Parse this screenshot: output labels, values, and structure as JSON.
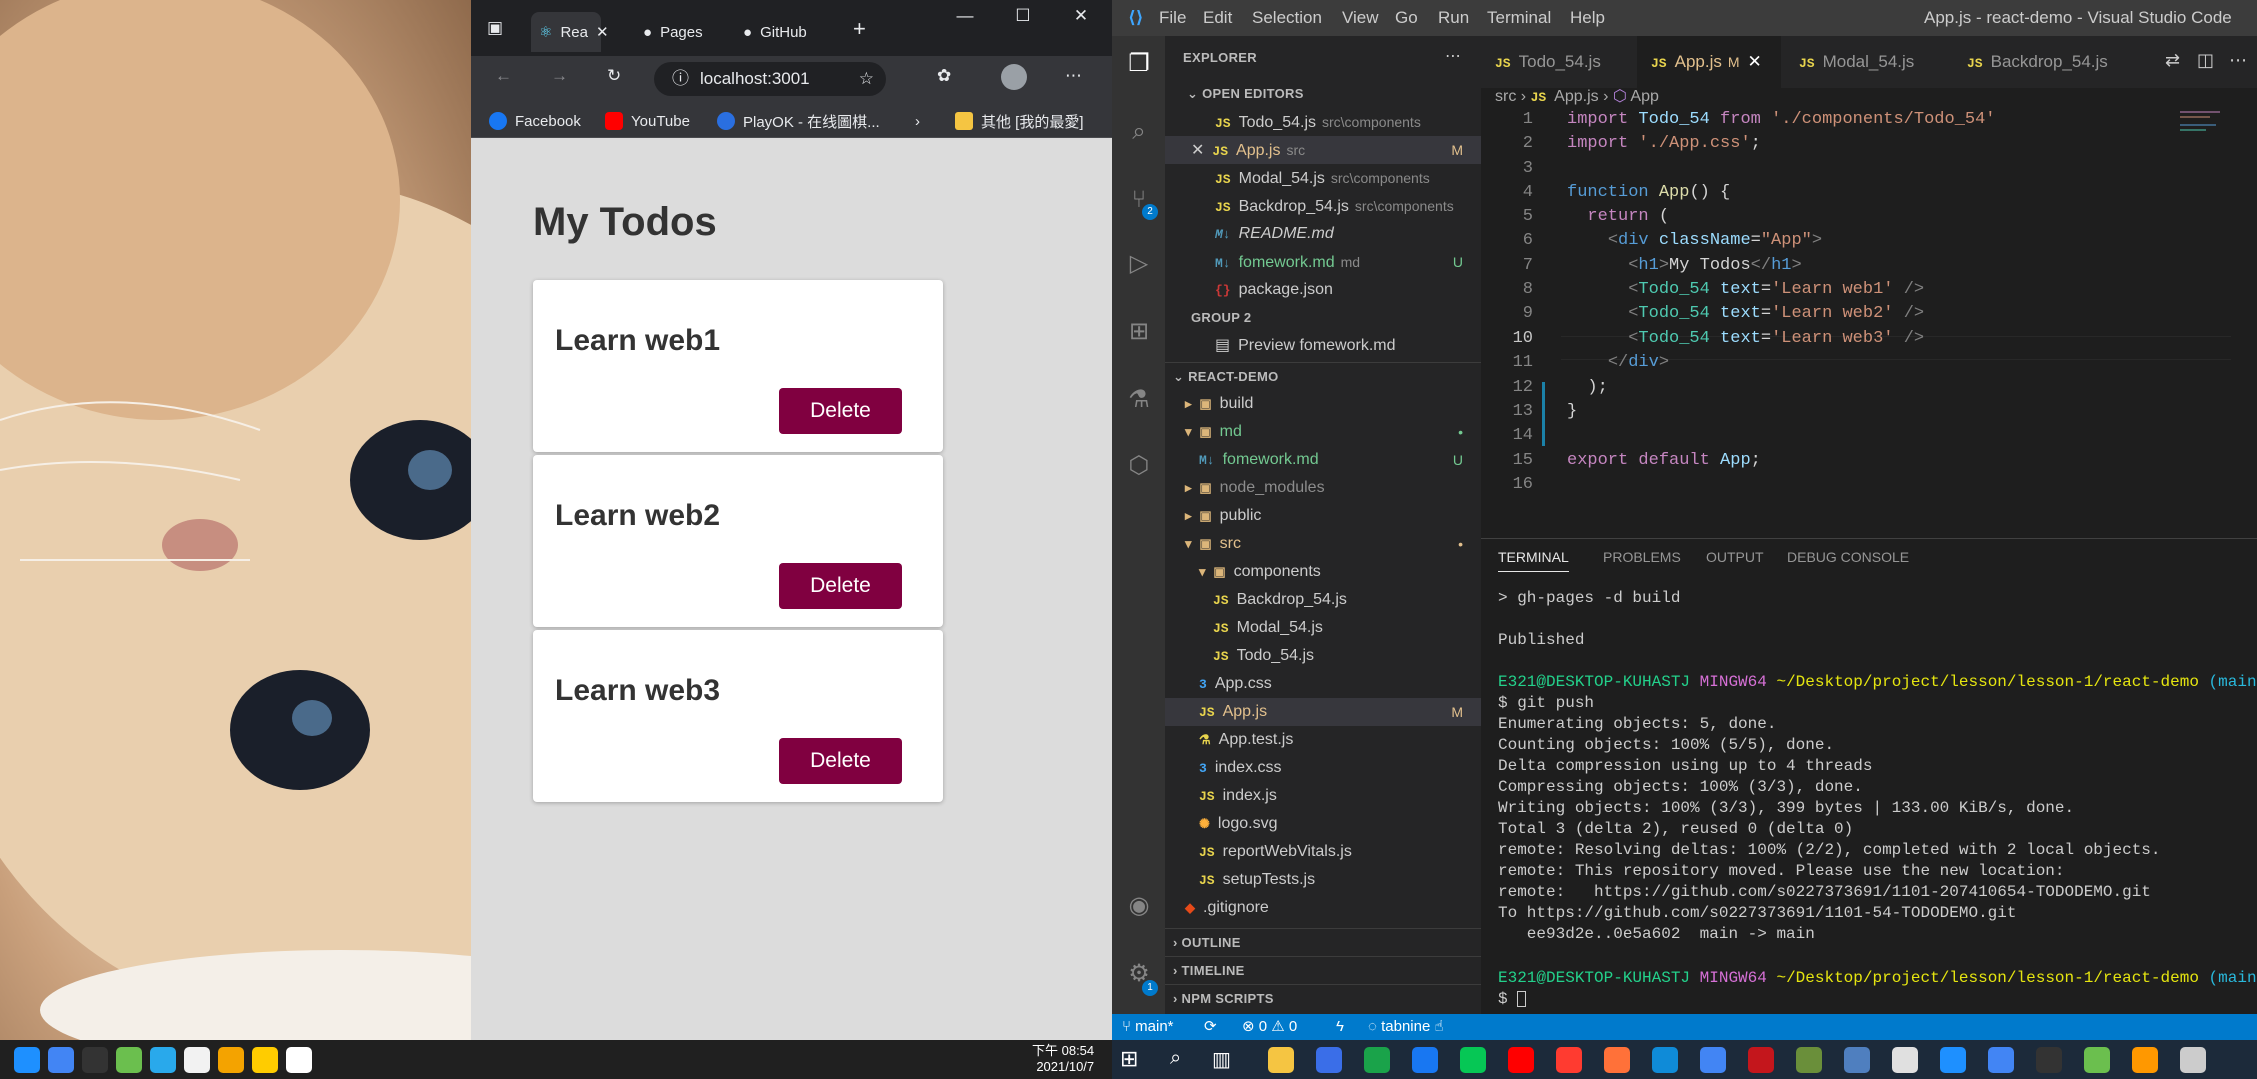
{
  "browser": {
    "tabs": [
      {
        "label": "Rea",
        "icon": "react-icon"
      },
      {
        "label": "Pages",
        "icon": "github-icon"
      },
      {
        "label": "GitHub",
        "icon": "github-icon"
      }
    ],
    "address": "localhost:3001",
    "bookmarks": [
      "Facebook",
      "YouTube",
      "PlayOK - 在线圖棋...",
      "其他 [我的最愛]"
    ]
  },
  "app": {
    "title": "My Todos",
    "todos": [
      {
        "text": "Learn web1",
        "button": "Delete"
      },
      {
        "text": "Learn web2",
        "button": "Delete"
      },
      {
        "text": "Learn web3",
        "button": "Delete"
      }
    ],
    "button_color": "#800040"
  },
  "vscode": {
    "menu": [
      "File",
      "Edit",
      "Selection",
      "View",
      "Go",
      "Run",
      "Terminal",
      "Help"
    ],
    "window_title": "App.js - react-demo - Visual Studio Code",
    "explorer_title": "EXPLORER",
    "open_editors_label": "OPEN EDITORS",
    "open_editors": [
      {
        "name": "Todo_54.js",
        "path": "src\\components",
        "badge": ""
      },
      {
        "name": "App.js",
        "path": "src",
        "badge": "M"
      },
      {
        "name": "Modal_54.js",
        "path": "src\\components",
        "badge": ""
      },
      {
        "name": "Backdrop_54.js",
        "path": "src\\components",
        "badge": ""
      },
      {
        "name": "README.md",
        "path": "",
        "badge": ""
      },
      {
        "name": "fomework.md",
        "path": "md",
        "badge": "U"
      },
      {
        "name": "package.json",
        "path": "",
        "badge": ""
      }
    ],
    "group2_label": "GROUP 2",
    "group2_item": "Preview fomework.md",
    "project_label": "REACT-DEMO",
    "tree": [
      {
        "name": "build",
        "kind": "folder",
        "badge": ""
      },
      {
        "name": "md",
        "kind": "folder-open",
        "badge": "•"
      },
      {
        "name": "fomework.md",
        "kind": "md",
        "badge": "U"
      },
      {
        "name": "node_modules",
        "kind": "folder",
        "badge": ""
      },
      {
        "name": "public",
        "kind": "folder",
        "badge": ""
      },
      {
        "name": "src",
        "kind": "folder-open",
        "badge": "•"
      },
      {
        "name": "components",
        "kind": "folder-open",
        "badge": ""
      },
      {
        "name": "Backdrop_54.js",
        "kind": "js",
        "badge": ""
      },
      {
        "name": "Modal_54.js",
        "kind": "js",
        "badge": ""
      },
      {
        "name": "Todo_54.js",
        "kind": "js",
        "badge": ""
      },
      {
        "name": "App.css",
        "kind": "css",
        "badge": ""
      },
      {
        "name": "App.js",
        "kind": "js",
        "badge": "M"
      },
      {
        "name": "App.test.js",
        "kind": "test",
        "badge": ""
      },
      {
        "name": "index.css",
        "kind": "css",
        "badge": ""
      },
      {
        "name": "index.js",
        "kind": "js",
        "badge": ""
      },
      {
        "name": "logo.svg",
        "kind": "svg",
        "badge": ""
      },
      {
        "name": "reportWebVitals.js",
        "kind": "js",
        "badge": ""
      },
      {
        "name": "setupTests.js",
        "kind": "js",
        "badge": ""
      },
      {
        "name": ".gitignore",
        "kind": "git",
        "badge": ""
      }
    ],
    "outline_label": "OUTLINE",
    "timeline_label": "TIMELINE",
    "npm_label": "NPM SCRIPTS",
    "editor_tabs": [
      {
        "name": "Todo_54.js",
        "badge": ""
      },
      {
        "name": "App.js",
        "badge": "M"
      },
      {
        "name": "Modal_54.js",
        "badge": ""
      },
      {
        "name": "Backdrop_54.js",
        "badge": ""
      }
    ],
    "breadcrumb": [
      "src",
      "App.js",
      "App"
    ],
    "line_numbers": [
      "1",
      "2",
      "3",
      "4",
      "5",
      "6",
      "7",
      "8",
      "9",
      "10",
      "11",
      "12",
      "13",
      "14",
      "15",
      "16"
    ],
    "panel_tabs": [
      "TERMINAL",
      "PROBLEMS",
      "OUTPUT",
      "DEBUG CONSOLE"
    ],
    "terminal": {
      "cmd1": "> gh-pages -d build",
      "published": "Published",
      "prompt_user": "E321@DESKTOP-KUHASTJ",
      "prompt_env": "MINGW64",
      "prompt_path": "~/Desktop/project/lesson/lesson-1/react-demo",
      "prompt_branch": "(main)",
      "cmd2": "$ git push",
      "output": [
        "Enumerating objects: 5, done.",
        "Counting objects: 100% (5/5), done.",
        "Delta compression using up to 4 threads",
        "Compressing objects: 100% (3/3), done.",
        "Writing objects: 100% (3/3), 399 bytes | 133.00 KiB/s, done.",
        "Total 3 (delta 2), reused 0 (delta 0)",
        "remote: Resolving deltas: 100% (2/2), completed with 2 local objects.",
        "remote: This repository moved. Please use the new location:",
        "remote:   https://github.com/s0227373691/1101-207410654-TODODEMO.git",
        "To https://github.com/s0227373691/1101-54-TODODEMO.git",
        "   ee93d2e..0e5a602  main -> main"
      ],
      "cursor_prompt": "$"
    },
    "status": {
      "branch": "main*",
      "errors": "0",
      "warnings": "0",
      "tabnine": "tabnine"
    },
    "source_control_badge": "2",
    "settings_badge": "1"
  },
  "taskbar": {
    "time": "下午 08:54",
    "date": "2021/10/7"
  }
}
